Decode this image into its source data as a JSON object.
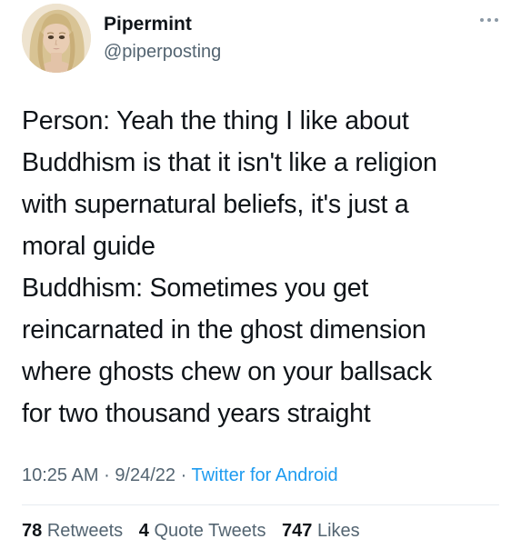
{
  "author": {
    "display_name": "Pipermint",
    "handle": "@piperposting",
    "avatar": "avatar-illustration"
  },
  "menu_icon": "more-horizontal-icon",
  "tweet": {
    "lines": [
      "Person: Yeah the thing I like about",
      "Buddhism is that it isn't like a religion",
      "with supernatural beliefs, it's just a",
      "moral guide",
      "Buddhism: Sometimes you get",
      "reincarnated in the ghost dimension",
      "where ghosts chew on your ballsack",
      "for two thousand years straight"
    ]
  },
  "meta": {
    "time": "10:25 AM",
    "separator": "·",
    "date": "9/24/22",
    "source": "Twitter for Android"
  },
  "stats": {
    "retweets_count": "78",
    "retweets_label": "Retweets",
    "quotes_count": "4",
    "quotes_label": "Quote Tweets",
    "likes_count": "747",
    "likes_label": "Likes"
  },
  "colors": {
    "text": "#0f1419",
    "secondary": "#536471",
    "link": "#1d9bf0",
    "divider": "#e6ecf0"
  }
}
